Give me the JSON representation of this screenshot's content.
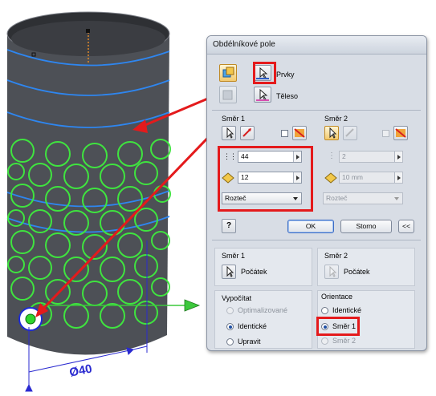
{
  "dialog": {
    "title": "Obdélníkové pole",
    "features_label": "Prvky",
    "body_label": "Těleso",
    "direction1": {
      "title": "Směr 1",
      "count": "44",
      "spacing": "12",
      "method": "Rozteč"
    },
    "direction2": {
      "title": "Směr 2",
      "count": "2",
      "spacing": "10 mm",
      "method": "Rozteč"
    },
    "buttons": {
      "ok": "OK",
      "cancel": "Storno",
      "more": "<<"
    },
    "start": {
      "dir1_title": "Směr 1",
      "dir1_label": "Počátek",
      "dir2_title": "Směr 2",
      "dir2_label": "Počátek"
    },
    "compute": {
      "title": "Vypočítat",
      "options": [
        "Optimalizované",
        "Identické",
        "Upravit"
      ],
      "selected": "Identické"
    },
    "orientation": {
      "title": "Orientace",
      "options": [
        "Identické",
        "Směr 1",
        "Směr 2"
      ],
      "selected": "Směr 1"
    }
  },
  "model": {
    "dimension_label": "Ø40"
  },
  "colors": {
    "cylinder": "#4d5056",
    "pattern_circles": "#3fe43f",
    "path_lines": "#2e86f0",
    "annotation_red": "#e41a1c",
    "axis_green": "#3cc83c",
    "dimension_blue": "#2a2ad0"
  }
}
